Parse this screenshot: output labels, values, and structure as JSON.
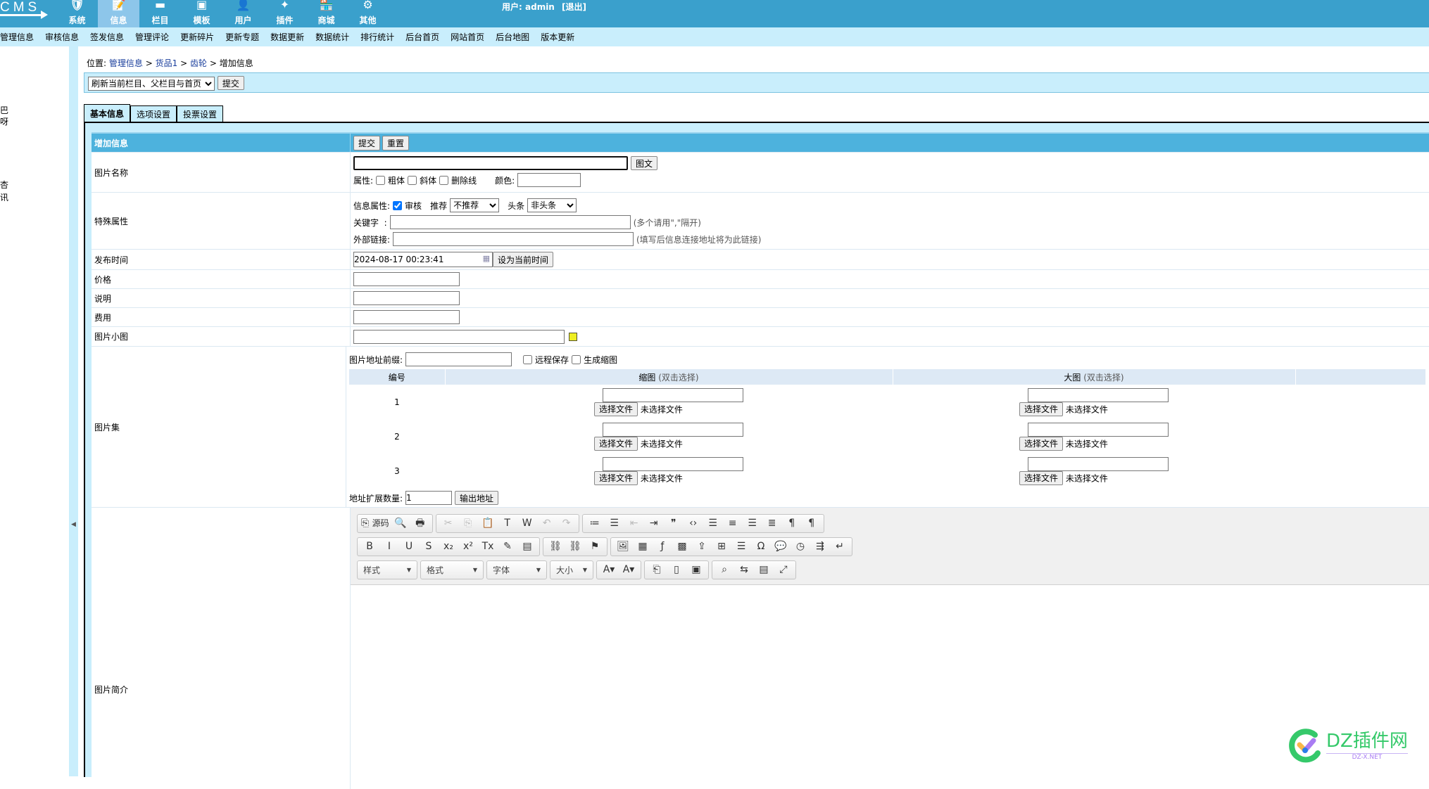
{
  "header": {
    "logo": "CMS",
    "user_label": "用户:",
    "user": "admin",
    "logout": "[退出]",
    "nav": [
      {
        "label": "系统",
        "icon": "shield-icon"
      },
      {
        "label": "信息",
        "icon": "pencil-note-icon",
        "active": true
      },
      {
        "label": "栏目",
        "icon": "column-icon"
      },
      {
        "label": "模板",
        "icon": "template-icon"
      },
      {
        "label": "用户",
        "icon": "user-icon"
      },
      {
        "label": "插件",
        "icon": "plugin-icon"
      },
      {
        "label": "商城",
        "icon": "shop-icon"
      },
      {
        "label": "其他",
        "icon": "gear-icon"
      }
    ]
  },
  "subnav": [
    "管理信息",
    "审核信息",
    "签发信息",
    "管理评论",
    "更新碎片",
    "更新专题",
    "数据更新",
    "数据统计",
    "排行统计",
    "后台首页",
    "网站首页",
    "后台地图",
    "版本更新"
  ],
  "sidebar": [
    "巴",
    "呀",
    "杏",
    "讯"
  ],
  "breadcrumb": {
    "prefix": "位置:",
    "items": [
      "管理信息",
      "货品1",
      "齿轮"
    ],
    "current": "增加信息",
    "sep": ">"
  },
  "refresh": {
    "selected": "刷新当前栏目、父栏目与首页",
    "submit": "提交"
  },
  "tabs": [
    "基本信息",
    "选项设置",
    "投票设置"
  ],
  "form": {
    "header": {
      "title": "增加信息",
      "submit": "提交",
      "reset": "重置"
    },
    "title_row": {
      "label": "图片名称",
      "value": "",
      "button": "图文",
      "attr_label": "属性:",
      "bold": "粗体",
      "italic": "斜体",
      "strike": "删除线",
      "color_label": "颜色:",
      "color_value": ""
    },
    "special": {
      "label": "特殊属性",
      "info_attr": "信息属性:",
      "audit": "审核",
      "audit_checked": true,
      "recommend_label": "推荐",
      "recommend": "不推荐",
      "headline_label": "头条",
      "headline": "非头条",
      "keyword_label": "关键字  :",
      "keyword_hint": "(多个请用\",\"隔开)",
      "link_label": "外部链接:",
      "link_hint": "(填写后信息连接地址将为此链接)"
    },
    "time": {
      "label": "发布时间",
      "value": "2024-08-17 00:23:41",
      "button": "设为当前时间"
    },
    "price": {
      "label": "价格"
    },
    "desc": {
      "label": "说明"
    },
    "fee": {
      "label": "费用"
    },
    "thumb": {
      "label": "图片小图"
    },
    "gallery": {
      "label": "图片集",
      "prefix_label": "图片地址前缀:",
      "remote_save": "远程保存",
      "gen_thumb": "生成缩图",
      "col_no": "编号",
      "col_thumb": "缩图",
      "col_big": "大图",
      "dbl": "(双击选择)",
      "choose": "选择文件",
      "none": "未选择文件",
      "rows": [
        "1",
        "2",
        "3"
      ],
      "ext_label": "地址扩展数量:",
      "ext_value": "1",
      "output": "输出地址"
    },
    "intro": {
      "label": "图片简介"
    }
  },
  "editor": {
    "row1": [
      [
        "source-icon:源码",
        "preview-icon",
        "print-icon"
      ],
      [
        "cut-icon:dis",
        "copy-icon:dis",
        "paste-icon",
        "paste-text-icon",
        "paste-word-icon",
        "undo-icon:dis",
        "redo-icon:dis"
      ],
      [
        "ordered-list-icon",
        "bullet-list-icon",
        "outdent-icon:dis",
        "indent-icon",
        "blockquote-icon",
        "div-icon",
        "align-left-icon",
        "align-center-icon",
        "align-right-icon",
        "justify-icon",
        "ltr-icon",
        "rtl-icon"
      ]
    ],
    "row2": [
      [
        "bold-icon",
        "italic-icon",
        "underline-icon",
        "strike-icon",
        "subscript-icon",
        "superscript-icon",
        "remove-format-icon",
        "copy-format-icon",
        "paste-from-icon"
      ],
      [
        "link-icon",
        "unlink-icon",
        "anchor-icon"
      ],
      [
        "image-icon",
        "calendar-icon",
        "flash-icon",
        "media-icon",
        "upload-icon",
        "table-icon",
        "hr-icon",
        "omega-icon",
        "bubble-icon",
        "clock-icon",
        "indent-list-icon",
        "br-icon"
      ]
    ],
    "combos": [
      "样式",
      "格式",
      "字体",
      "大小"
    ],
    "row3": [
      [
        "text-color-icon",
        "bg-color-icon"
      ],
      [
        "page-break-icon",
        "new-page-icon",
        "template-icon"
      ],
      [
        "find-icon",
        "replace-icon",
        "select-all-icon",
        "maximize-icon"
      ]
    ]
  },
  "watermark": {
    "brand": "DZ插件网",
    "site": "DZ-X.NET"
  }
}
